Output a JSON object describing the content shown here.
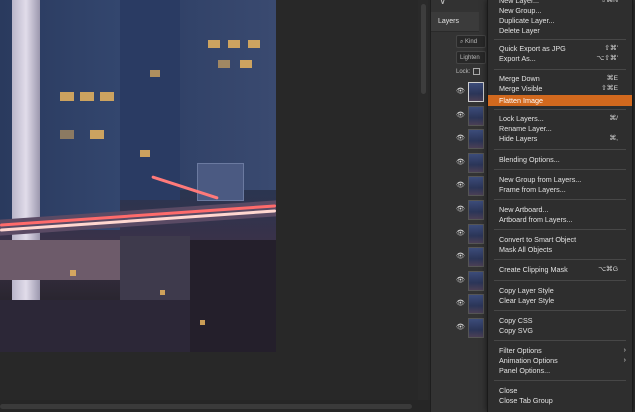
{
  "canvas": {
    "image_label": "city night photo with light trails"
  },
  "panel": {
    "tab": "Layers",
    "kind_filter": "Kind",
    "blend_mode": "Lighten",
    "lock_label": "Lock:",
    "layer_count": 11
  },
  "menu": {
    "items": [
      {
        "label": "New Layer...",
        "shortcut": "⇧⌘N"
      },
      {
        "label": "New Group...",
        "shortcut": ""
      },
      {
        "label": "Duplicate Layer...",
        "shortcut": ""
      },
      {
        "label": "Delete Layer",
        "shortcut": ""
      },
      {
        "label": "Quick Export as JPG",
        "shortcut": "⇧⌘'"
      },
      {
        "label": "Export As...",
        "shortcut": "⌥⇧⌘'"
      },
      {
        "label": "Merge Down",
        "shortcut": "⌘E"
      },
      {
        "label": "Merge Visible",
        "shortcut": "⇧⌘E"
      },
      {
        "label": "Flatten Image",
        "shortcut": ""
      },
      {
        "label": "Lock Layers...",
        "shortcut": "⌘/"
      },
      {
        "label": "Rename Layer...",
        "shortcut": ""
      },
      {
        "label": "Hide Layers",
        "shortcut": "⌘,"
      },
      {
        "label": "Blending Options...",
        "shortcut": ""
      },
      {
        "label": "New Group from Layers...",
        "shortcut": ""
      },
      {
        "label": "Frame from Layers...",
        "shortcut": ""
      },
      {
        "label": "New Artboard...",
        "shortcut": ""
      },
      {
        "label": "Artboard from Layers...",
        "shortcut": ""
      },
      {
        "label": "Convert to Smart Object",
        "shortcut": ""
      },
      {
        "label": "Mask All Objects",
        "shortcut": ""
      },
      {
        "label": "Create Clipping Mask",
        "shortcut": "⌥⌘G"
      },
      {
        "label": "Copy Layer Style",
        "shortcut": ""
      },
      {
        "label": "Clear Layer Style",
        "shortcut": ""
      },
      {
        "label": "Copy CSS",
        "shortcut": ""
      },
      {
        "label": "Copy SVG",
        "shortcut": ""
      },
      {
        "label": "Filter Options",
        "shortcut": ""
      },
      {
        "label": "Animation Options",
        "shortcut": ""
      },
      {
        "label": "Panel Options...",
        "shortcut": ""
      },
      {
        "label": "Close",
        "shortcut": ""
      },
      {
        "label": "Close Tab Group",
        "shortcut": ""
      }
    ],
    "highlighted": "Flatten Image",
    "accent_color": "#d2691e"
  }
}
